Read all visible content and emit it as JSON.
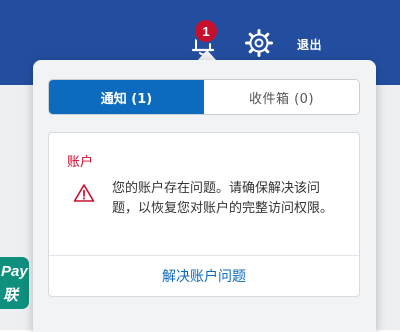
{
  "header": {
    "notification_count": "1",
    "logout_label": "退出"
  },
  "side_logo": {
    "line1": "Pay",
    "line2": "联"
  },
  "panel": {
    "tabs": [
      {
        "label": "通知 (1)",
        "active": true
      },
      {
        "label": "收件箱 (0)",
        "active": false
      }
    ],
    "card": {
      "title": "账户",
      "message": "您的账户存在问题。请确保解决该问题，以恢复您对账户的完整访问权限。",
      "action_label": "解决账户问题"
    }
  },
  "colors": {
    "header_bg": "#234ea0",
    "badge": "#c8102e",
    "tab_active": "#0d6bbf",
    "alert_red": "#c8102e",
    "link_blue": "#0d6bbf"
  },
  "icons": [
    "bell-icon",
    "gear-icon",
    "warning-icon"
  ]
}
